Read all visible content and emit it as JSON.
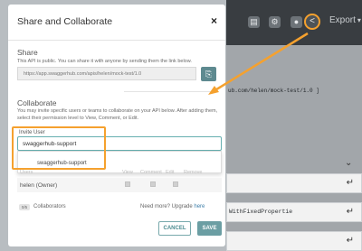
{
  "background_app": {
    "export_label": "Export",
    "code_line": "ub.com/helen/mock-test/1.0 ]",
    "panel_texts": [
      "",
      "WithFixedPropertie",
      "",
      ""
    ]
  },
  "modal": {
    "title": "Share and Collaborate",
    "close_label": "×",
    "share": {
      "heading": "Share",
      "description": "This API is public. You can share it with anyone by sending them the link below.",
      "link": "https://app.swaggerhub.com/apis/helen/mock-test/1.0"
    },
    "collaborate": {
      "heading": "Collaborate",
      "description": "You may invite specific users or teams to collaborate on your API below. After adding them, select their permission level to View, Comment, or Edit.",
      "invite_label": "Invite User",
      "invite_value": "swaggerhub-support",
      "suggestion": "swaggerhub-support",
      "columns": [
        "Users",
        "View",
        "Comment",
        "Edit",
        "Remove"
      ],
      "members": [
        {
          "name": "helen (Owner)"
        }
      ],
      "collaborator_count": "0/5",
      "collaborators_label": "Collaborators",
      "upgrade_prefix": "Need more? Upgrade ",
      "upgrade_link": "here"
    },
    "buttons": {
      "cancel": "CANCEL",
      "save": "SAVE"
    }
  },
  "colors": {
    "accent": "#6b9ea3",
    "highlight": "#f5a12e",
    "topbar": "#393d41"
  }
}
